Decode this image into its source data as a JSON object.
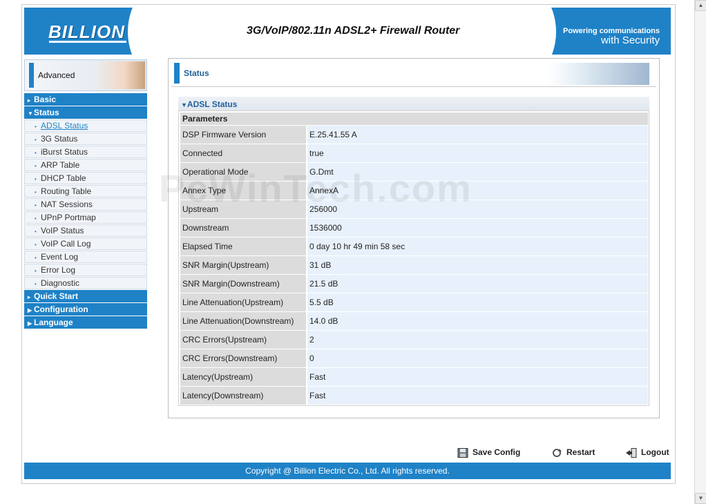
{
  "header": {
    "logo": "BILLION",
    "title": "3G/VoIP/802.11n ADSL2+ Firewall Router",
    "slogan_line1": "Powering communications",
    "slogan_line2": "with Security"
  },
  "sidebar": {
    "mode_label": "Advanced",
    "categories": [
      {
        "label": "Basic"
      },
      {
        "label": "Status"
      },
      {
        "label": "Quick Start"
      },
      {
        "label": "Configuration"
      },
      {
        "label": "Language"
      }
    ],
    "status_items": [
      {
        "label": "ADSL Status"
      },
      {
        "label": "3G Status"
      },
      {
        "label": "iBurst Status"
      },
      {
        "label": "ARP Table"
      },
      {
        "label": "DHCP Table"
      },
      {
        "label": "Routing Table"
      },
      {
        "label": "NAT Sessions"
      },
      {
        "label": "UPnP Portmap"
      },
      {
        "label": "VoIP Status"
      },
      {
        "label": "VoIP Call Log"
      },
      {
        "label": "Event Log"
      },
      {
        "label": "Error Log"
      },
      {
        "label": "Diagnostic"
      }
    ]
  },
  "panel": {
    "title": "Status",
    "section_title": "ADSL Status",
    "params_header": "Parameters",
    "rows": [
      {
        "key": "DSP Firmware Version",
        "value": "E.25.41.55 A"
      },
      {
        "key": "Connected",
        "value": "true"
      },
      {
        "key": "Operational Mode",
        "value": "G.Dmt"
      },
      {
        "key": "Annex Type",
        "value": "AnnexA"
      },
      {
        "key": "Upstream",
        "value": "256000"
      },
      {
        "key": "Downstream",
        "value": "1536000"
      },
      {
        "key": "Elapsed Time",
        "value": "0 day 10 hr 49 min 58 sec"
      },
      {
        "key": "SNR Margin(Upstream)",
        "value": "31 dB"
      },
      {
        "key": "SNR Margin(Downstream)",
        "value": "21.5 dB"
      },
      {
        "key": "Line Attenuation(Upstream)",
        "value": "5.5 dB"
      },
      {
        "key": "Line Attenuation(Downstream)",
        "value": "14.0 dB"
      },
      {
        "key": "CRC Errors(Upstream)",
        "value": "2"
      },
      {
        "key": "CRC Errors(Downstream)",
        "value": "0"
      },
      {
        "key": "Latency(Upstream)",
        "value": "Fast"
      },
      {
        "key": "Latency(Downstream)",
        "value": "Fast"
      }
    ]
  },
  "watermark": "PcWinTech.com",
  "actions": {
    "save": "Save Config",
    "restart": "Restart",
    "logout": "Logout"
  },
  "footer": "Copyright @ Billion Electric Co., Ltd. All rights reserved.",
  "colors": {
    "accent": "#1f82c7"
  }
}
